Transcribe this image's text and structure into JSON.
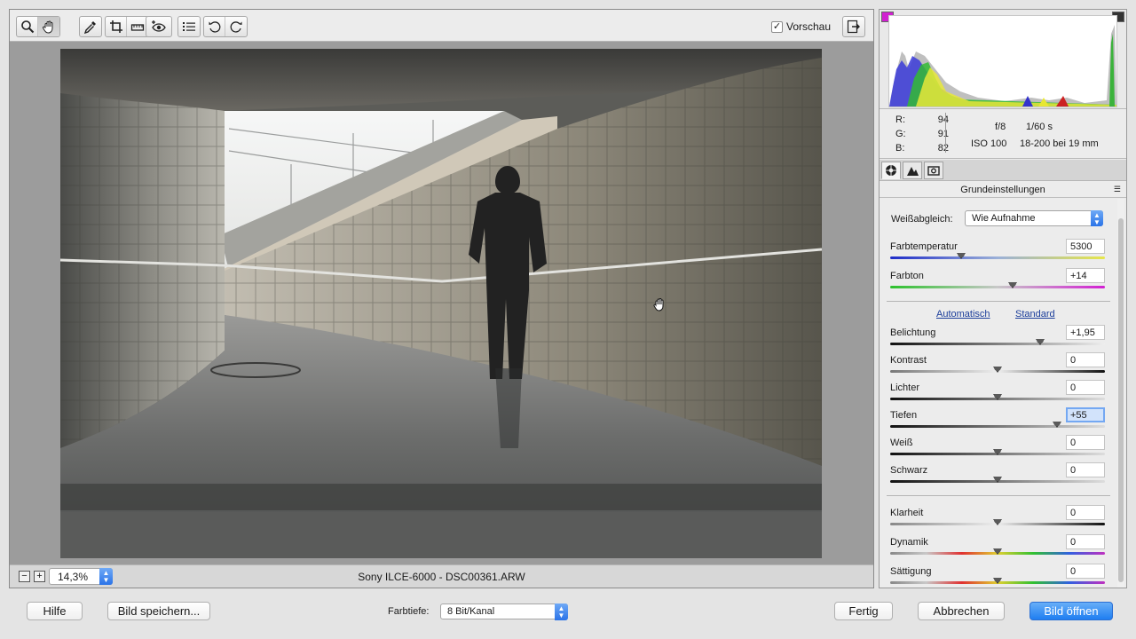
{
  "toolbar": {
    "tools": [
      {
        "name": "zoom-tool",
        "icon": "magnifier-icon"
      },
      {
        "name": "hand-tool",
        "icon": "hand-icon",
        "active": true
      },
      {
        "name": "white-balance-tool",
        "icon": "eyedropper-icon"
      },
      {
        "name": "crop-tool",
        "icon": "crop-icon"
      },
      {
        "name": "straighten-tool",
        "icon": "straighten-icon"
      },
      {
        "name": "red-eye-tool",
        "icon": "red-eye-icon"
      },
      {
        "name": "preferences",
        "icon": "list-icon"
      },
      {
        "name": "rotate-left",
        "icon": "rotate-left-icon"
      },
      {
        "name": "rotate-right",
        "icon": "rotate-right-icon"
      }
    ],
    "preview_label": "Vorschau",
    "preview_checked": "✓"
  },
  "status": {
    "zoom_value": "14,3%",
    "filename": "Sony ILCE-6000 - DSC00361.ARW"
  },
  "info": {
    "r_label": "R:",
    "r_value": "94",
    "g_label": "G:",
    "g_value": "91",
    "b_label": "B:",
    "b_value": "82",
    "aperture": "f/8",
    "shutter": "1/60 s",
    "iso": "ISO 100",
    "lens": "18-200 bei 19 mm"
  },
  "panel": {
    "section_title": "Grundeinstellungen",
    "white_balance_label": "Weißabgleich:",
    "white_balance_value": "Wie Aufnahme",
    "auto_link": "Automatisch",
    "default_link": "Standard"
  },
  "sliders": [
    {
      "name": "farbtemperatur",
      "label": "Farbtemperatur",
      "value": "5300",
      "position": 0.33
    },
    {
      "name": "farbton",
      "label": "Farbton",
      "value": "+14",
      "position": 0.57
    },
    {
      "name": "belichtung",
      "label": "Belichtung",
      "value": "+1,95",
      "position": 0.7
    },
    {
      "name": "kontrast",
      "label": "Kontrast",
      "value": "0",
      "position": 0.5
    },
    {
      "name": "lichter",
      "label": "Lichter",
      "value": "0",
      "position": 0.5
    },
    {
      "name": "tiefen",
      "label": "Tiefen",
      "value": "+55",
      "position": 0.775
    },
    {
      "name": "weiss",
      "label": "Weiß",
      "value": "0",
      "position": 0.5
    },
    {
      "name": "schwarz",
      "label": "Schwarz",
      "value": "0",
      "position": 0.5
    },
    {
      "name": "klarheit",
      "label": "Klarheit",
      "value": "0",
      "position": 0.5
    },
    {
      "name": "dynamik",
      "label": "Dynamik",
      "value": "0",
      "position": 0.5
    },
    {
      "name": "saettigung",
      "label": "Sättigung",
      "value": "0",
      "position": 0.5
    }
  ],
  "bottom": {
    "help": "Hilfe",
    "save": "Bild speichern...",
    "depth_label": "Farbtiefe:",
    "depth_value": "8 Bit/Kanal",
    "done": "Fertig",
    "cancel": "Abbrechen",
    "open": "Bild öffnen"
  }
}
